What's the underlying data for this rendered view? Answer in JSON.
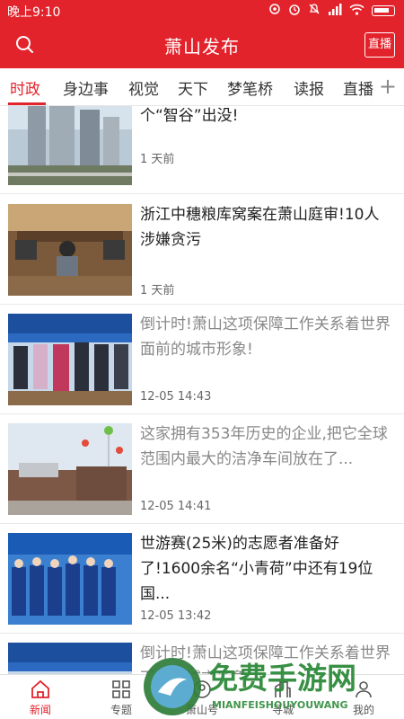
{
  "status_bar": {
    "time": "晚上9:10"
  },
  "header": {
    "title": "萧山发布",
    "live_label": "直播"
  },
  "tabs": [
    {
      "label": "时政",
      "active": true
    },
    {
      "label": "身边事"
    },
    {
      "label": "视觉"
    },
    {
      "label": "天下"
    },
    {
      "label": "梦笔桥"
    },
    {
      "label": "读报"
    },
    {
      "label": "直播"
    }
  ],
  "feed": [
    {
      "title": "大动作!数字经济独角兽将在萧山这个“智谷”出没!",
      "time": "1 天前",
      "read": false
    },
    {
      "title": "浙江中穗粮库窝案在萧山庭审!10人涉嫌贪污",
      "time": "1 天前",
      "read": false
    },
    {
      "title": "倒计时!萧山这项保障工作关系着世界面前的城市形象!",
      "time": "12-05 14:43",
      "read": true
    },
    {
      "title": "这家拥有353年历史的企业,把它全球范围内最大的洁净车间放在了...",
      "time": "12-05 14:41",
      "read": true
    },
    {
      "title": "世游赛(25米)的志愿者准备好了!1600余名“小青荷”中还有19位国...",
      "time": "12-05 13:42",
      "read": false
    },
    {
      "title": "倒计时!萧山这项保障工作关系着世界面前的城市形象!",
      "time": "",
      "read": true
    }
  ],
  "bottom_nav": [
    {
      "label": "新闻",
      "icon": "home-icon",
      "active": true
    },
    {
      "label": "专题",
      "icon": "grid-icon"
    },
    {
      "label": "萧山号",
      "icon": "account-icon"
    },
    {
      "label": "寻城",
      "icon": "city-icon"
    },
    {
      "label": "我的",
      "icon": "user-icon"
    }
  ],
  "watermark": {
    "text_cn": "免费手游网",
    "text_en": "MIANFEISHOUYOUWANG"
  },
  "colors": {
    "brand": "#e3232c",
    "text": "#222222",
    "muted": "#888888"
  }
}
